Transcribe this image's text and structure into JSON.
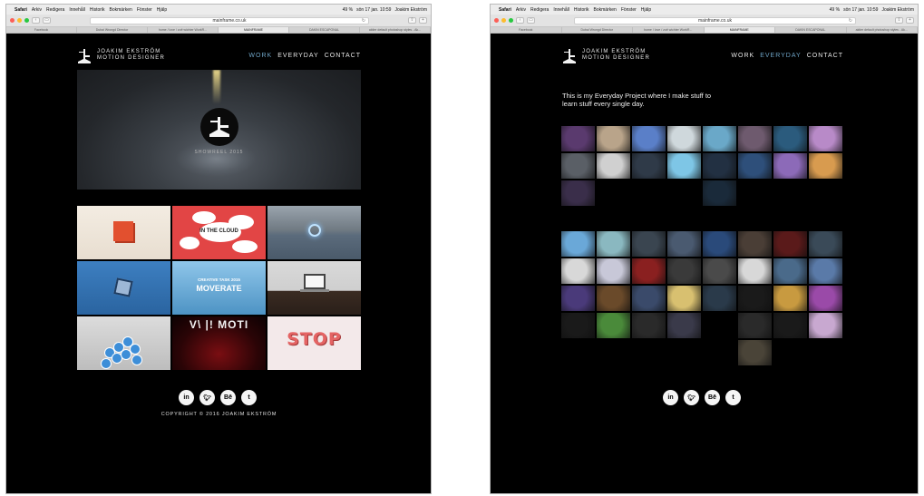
{
  "browser": {
    "menubar": [
      "Safari",
      "Arkiv",
      "Redigera",
      "Innehåll",
      "Historik",
      "Bokmärken",
      "Fönster",
      "Hjälp"
    ],
    "status": [
      "49 %",
      "sön 17 jan. 10:59",
      "Joakim Ekström"
    ],
    "url": "mainframe.co.uk",
    "tabs_left": [
      "Facebook",
      "Dubai Wrongd Director",
      "home / love / zoë wichter WorkR...",
      "MAINFRAME",
      "DAKIN ESCAPONAL",
      "aktier default photoshop styles - Ak..."
    ],
    "tabs_right": [
      "Facebook",
      "Dubai Wrongd Director",
      "home / love / zoë wichter WorkR...",
      "MAINFRAME",
      "DAKIN ESCAPONAL",
      "aktier default photoshop styles - Ak..."
    ],
    "active_tab_index": 3
  },
  "site": {
    "brand_line1": "JOAKIM EKSTRÖM",
    "brand_line2": "MOTION DESIGNER",
    "nav": [
      "WORK",
      "EVERYDAY",
      "CONTACT"
    ]
  },
  "work_page": {
    "active_nav": "WORK",
    "showreel_label": "SHOWREEL 2015",
    "tiles": [
      {
        "name": "cube"
      },
      {
        "name": "in-the-cloud",
        "text": "IN THE CLOUD"
      },
      {
        "name": "water-ring"
      },
      {
        "name": "blue-box"
      },
      {
        "name": "moverate",
        "sub": "CREATIVE TASK 2015",
        "text": "MOVERATE"
      },
      {
        "name": "laptop"
      },
      {
        "name": "blue-balls"
      },
      {
        "name": "motion",
        "text": "V\\ |! MOTI"
      },
      {
        "name": "stop",
        "text": "STOP"
      }
    ],
    "copyright": "COPYRIGHT © 2016 JOAKIM EKSTRÖM"
  },
  "everyday_page": {
    "active_nav": "EVERYDAY",
    "intro": "This is my Everyday Project where I make stuff to learn stuff every single day.",
    "grid_a_colors": [
      "#5a3a6e",
      "#b9a48a",
      "#5a7fc8",
      "#cfd8dc",
      "#6aa8c8",
      "#6e5a6e",
      "#2b5b7d",
      "#b88ac8",
      "#5a5f66",
      "#d0d0d0",
      "#2f3a48",
      "#7ec6e6",
      "#223042",
      "#2e4f7a",
      "#8c6ab8",
      "#d89b4f",
      "#3a2e4a",
      "",
      "",
      "",
      "#1a2a3a",
      "",
      "",
      ""
    ],
    "grid_b_colors": [
      "#6aa8d8",
      "#8ab8c0",
      "#3a4550",
      "#4a5a70",
      "#2a4a7a",
      "#4a3e36",
      "#5a1a1a",
      "#3a4a58",
      "#d8d8d8",
      "#c8c8d8",
      "#8a2020",
      "#3a3a3a",
      "#4a4a4a",
      "#d8d8d8",
      "#4a6a8a",
      "#5a7aa8",
      "#4a3a7a",
      "#6a4a2a",
      "#3a4a6a",
      "#d8c070",
      "#2a3a4a",
      "#1a1a1a",
      "#c89a40",
      "#9a4aa8",
      "#1a1a1a",
      "#4a8a3a",
      "#2a2a2a",
      "#3a3a4a",
      "",
      "#2a2a2a",
      "#1a1a1a",
      "#c8a8d0",
      "",
      "",
      "",
      "",
      "",
      "#4a4438",
      "",
      ""
    ]
  },
  "social": [
    "in",
    "t",
    "Bē",
    "t"
  ]
}
